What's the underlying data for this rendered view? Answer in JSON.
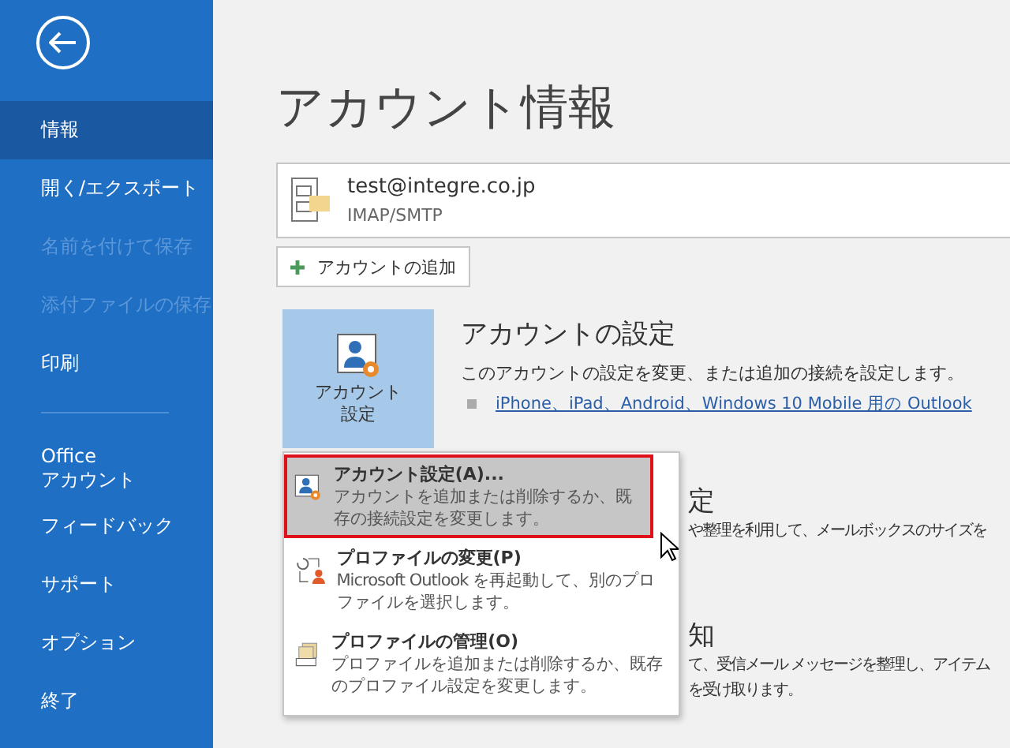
{
  "sidebar": {
    "items": [
      {
        "label": "情報",
        "selected": true,
        "disabled": false
      },
      {
        "label": "開く/エクスポート",
        "selected": false,
        "disabled": false
      },
      {
        "label": "名前を付けて保存",
        "selected": false,
        "disabled": true
      },
      {
        "label": "添付ファイルの保存",
        "selected": false,
        "disabled": true
      },
      {
        "label": "印刷",
        "selected": false,
        "disabled": false
      },
      {
        "kind": "divider"
      },
      {
        "label": "Office\nアカウント",
        "selected": false,
        "disabled": false
      },
      {
        "label": "フィードバック",
        "selected": false,
        "disabled": false
      },
      {
        "label": "サポート",
        "selected": false,
        "disabled": false
      },
      {
        "label": "オプション",
        "selected": false,
        "disabled": false
      },
      {
        "label": "終了",
        "selected": false,
        "disabled": false
      }
    ]
  },
  "page_title": "アカウント情報",
  "account": {
    "email": "test@integre.co.jp",
    "type": "IMAP/SMTP"
  },
  "add_account_button": "アカウントの追加",
  "account_settings": {
    "tile_label": [
      "アカウント",
      "設定"
    ],
    "expanded": true,
    "heading": "アカウントの設定",
    "description": "このアカウントの設定を変更、または追加の接続を設定します。",
    "link": "iPhone、iPad、Android、Windows 10 Mobile 用の Outlook"
  },
  "partly_hidden_sections": [
    {
      "heading": "定",
      "lines": [
        "や整理を利用して、メールボックスのサイズを"
      ]
    },
    {
      "heading": "知",
      "lines": [
        "て、受信メール メッセージを整理し、アイテム",
        "を受け取ります。"
      ]
    }
  ],
  "menu": {
    "items": [
      {
        "kind": "account",
        "title": "アカウント設定(A)...",
        "description": "アカウントを追加または削除するか、既存の接続設定を変更します。",
        "highlighted": true
      },
      {
        "kind": "change-profile",
        "title": "プロファイルの変更(P)",
        "description": "Microsoft Outlook を再起動して、別のプロファイルを選択します。",
        "highlighted": false
      },
      {
        "kind": "manage-profile",
        "title": "プロファイルの管理(O)",
        "description": "プロファイルを追加または削除するか、既存のプロファイル設定を変更します。",
        "highlighted": false
      }
    ]
  }
}
